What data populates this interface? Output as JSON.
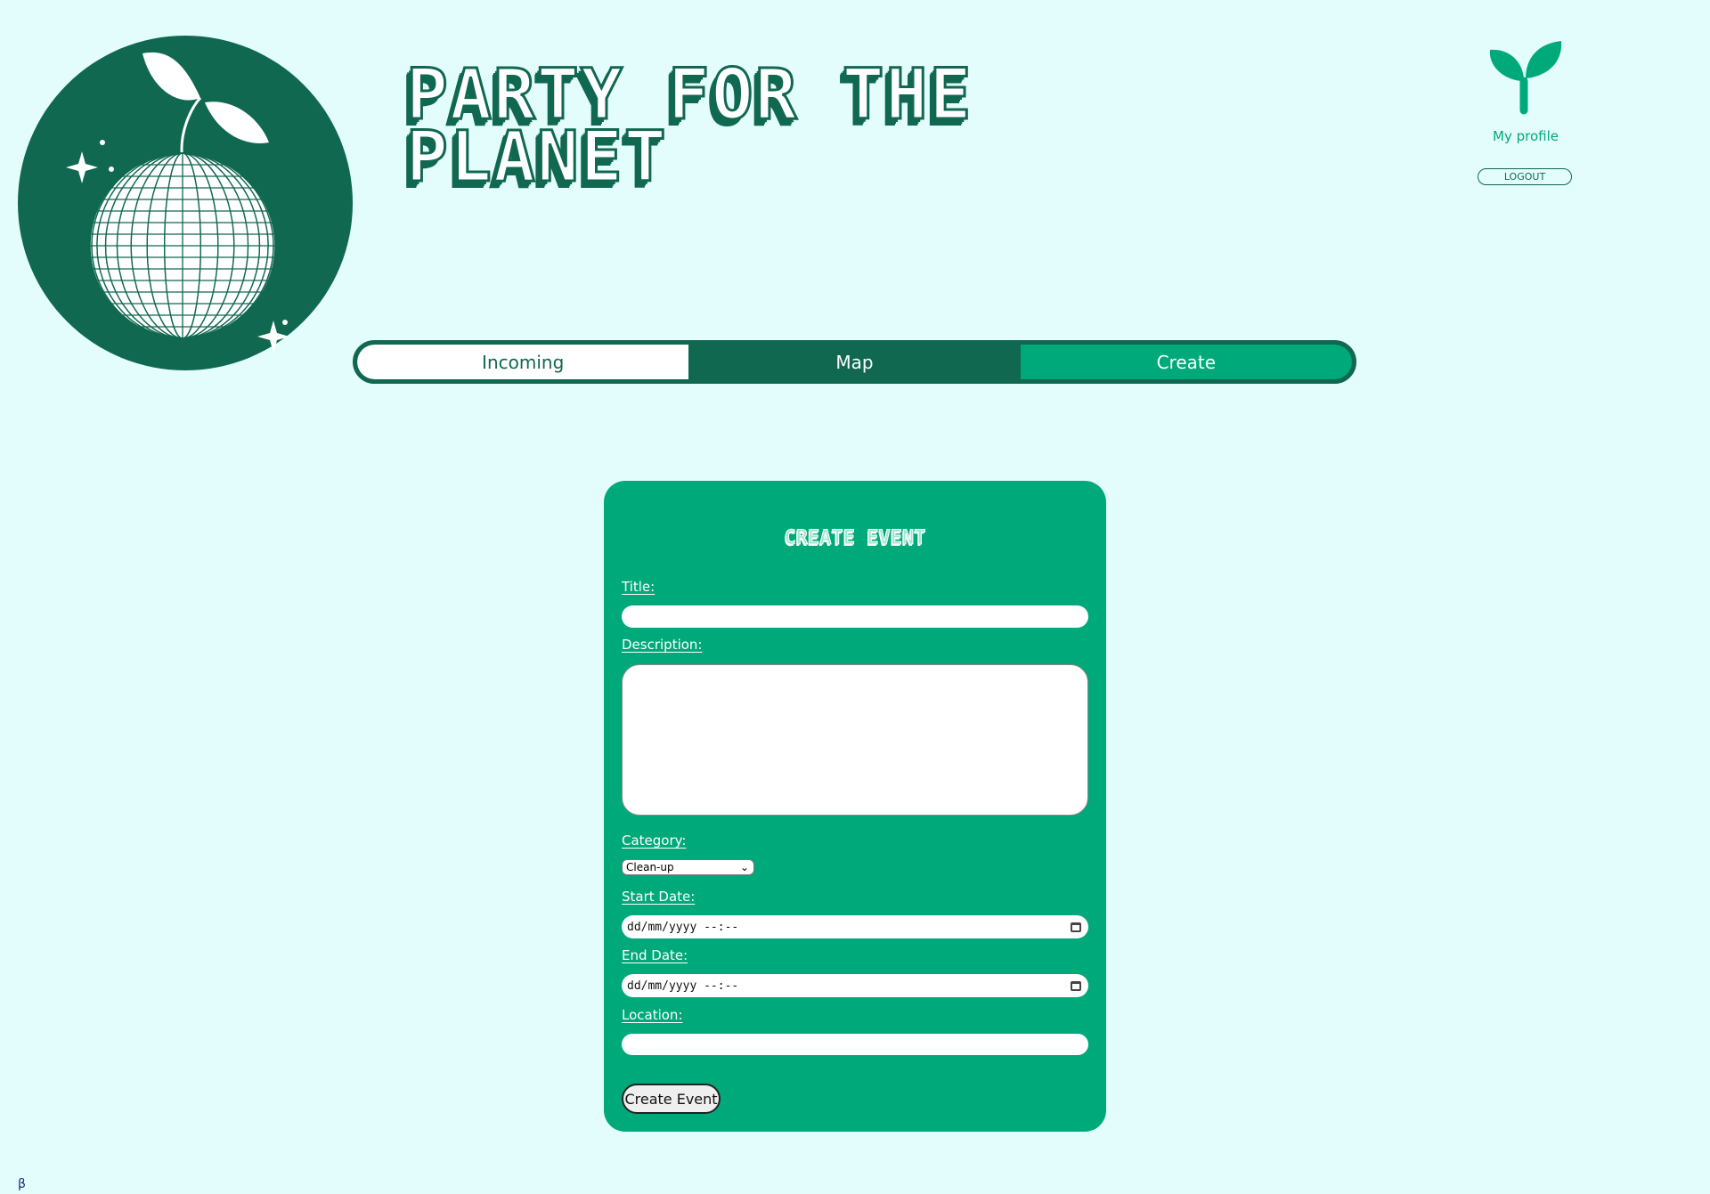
{
  "header": {
    "title_line1": "PARTY FOR THE",
    "title_line2": "PLANET",
    "profile_label": "My profile",
    "logout_label": "LOGOUT"
  },
  "nav": {
    "tabs": [
      {
        "label": "Incoming"
      },
      {
        "label": "Map"
      },
      {
        "label": "Create"
      }
    ],
    "active": "Create"
  },
  "form": {
    "heading": "CREATE EVENT",
    "title_label": "Title:",
    "title_value": "",
    "description_label": "Description:",
    "description_value": "",
    "category_label": "Category:",
    "category_value": "Clean-up",
    "start_label": "Start Date:",
    "start_placeholder": "dd/mm/yyyy --:--",
    "end_label": "End Date:",
    "end_placeholder": "dd/mm/yyyy --:--",
    "location_label": "Location:",
    "location_value": "",
    "submit_label": "Create Event"
  },
  "footer": {
    "symbol": "β"
  },
  "colors": {
    "background": "#e3fdfd",
    "dark_green": "#106850",
    "accent_green": "#00a97a"
  }
}
